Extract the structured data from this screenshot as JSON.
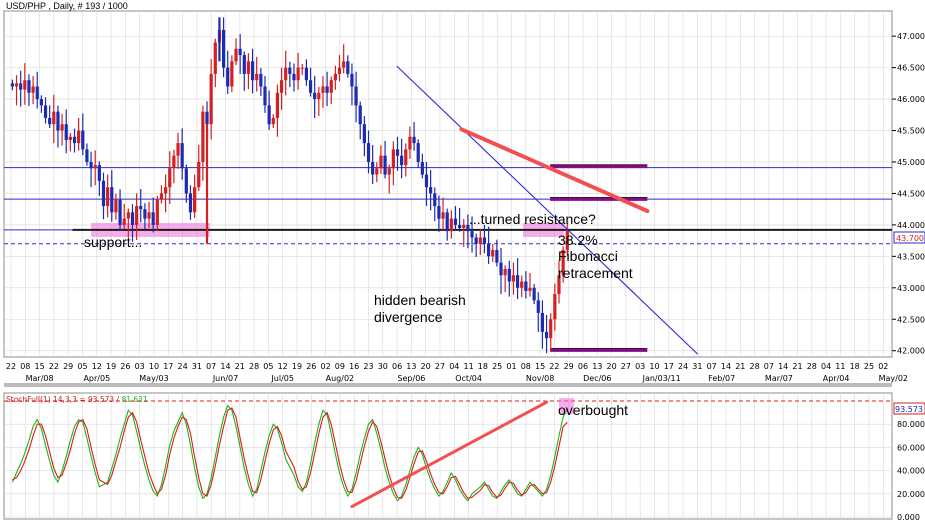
{
  "window": {
    "title": "USD/PHP , Daily, # 193 / 1000"
  },
  "colors": {
    "bull": "#d42020",
    "bear": "#1c2bb0",
    "hline": "#2a2ad6",
    "pivot": "#1a1a1a",
    "current": "#2a2ad6",
    "trend": "#f25050",
    "pink": "#f06ad8",
    "magenta": "#8a0a8a",
    "stochK": "#1db51d",
    "stochD": "#e01818",
    "grid": "#d8d8d8"
  },
  "annotations": {
    "support": "support...",
    "resistance": "...turned resistance?",
    "fib1": "38.2%",
    "fib2": "Fibonacci",
    "fib3": "retracement",
    "div1": "hidden bearish",
    "div2": "divergence",
    "overbought": "overbought"
  },
  "price_badge": "43.700",
  "stoch_badge": "93.573",
  "chart_data": [
    {
      "type": "candlestick",
      "title": "USD/PHP , Daily, # 193 / 1000",
      "y_ticks": [
        "47.000",
        "46.500",
        "46.000",
        "45.500",
        "45.000",
        "44.500",
        "44.000",
        "43.500",
        "43.000",
        "42.500",
        "42.000"
      ],
      "ylim": [
        41.9,
        47.4
      ],
      "x_day_labels": [
        "22",
        "08",
        "15",
        "22",
        "29",
        "05",
        "12",
        "19",
        "26",
        "03",
        "10",
        "17",
        "24",
        "31",
        "07",
        "14",
        "21",
        "28",
        "05",
        "12",
        "19",
        "26",
        "02",
        "09",
        "16",
        "23",
        "30",
        "06",
        "13",
        "20",
        "27",
        "04",
        "11",
        "18",
        "25",
        "01",
        "08",
        "15",
        "22",
        "29",
        "06",
        "13",
        "20",
        "27",
        "03",
        "10",
        "17",
        "24",
        "31",
        "07",
        "14",
        "21",
        "28",
        "07",
        "14",
        "21",
        "28",
        "04",
        "11",
        "18",
        "25",
        "02"
      ],
      "x_month_labels": [
        "Mar/08",
        "Apr/05",
        "May/03",
        "Jun/07",
        "Jul/05",
        "Aug/02",
        "Sep/06",
        "Oct/04",
        "Nov/08",
        "Dec/06",
        "Jan/03/11",
        "Feb/07",
        "Mar/07",
        "Apr/04",
        "May/02"
      ],
      "levels": [
        {
          "price": 44.91,
          "label": "resistance"
        },
        {
          "price": 44.41,
          "label": "resistance"
        },
        {
          "price": 43.92,
          "label": "support turned resistance"
        },
        {
          "price": 43.7,
          "label": "current price"
        }
      ],
      "magenta_levels": [
        44.93,
        44.41,
        42.01
      ],
      "current_price": 43.7,
      "closes": [
        46.2,
        46.25,
        46.15,
        46.3,
        46.1,
        46.2,
        46.0,
        45.9,
        45.7,
        45.6,
        45.8,
        45.5,
        45.6,
        45.35,
        45.4,
        45.3,
        45.5,
        45.2,
        45.0,
        44.9,
        44.95,
        44.7,
        44.3,
        44.6,
        44.2,
        44.4,
        44.0,
        44.1,
        44.2,
        44.0,
        44.3,
        44.25,
        44.1,
        44.2,
        44.0,
        44.4,
        44.5,
        44.6,
        44.9,
        45.1,
        45.3,
        44.9,
        44.5,
        44.2,
        44.6,
        45.0,
        45.8,
        45.6,
        46.4,
        46.9,
        47.1,
        46.5,
        46.2,
        46.6,
        46.8,
        46.7,
        46.4,
        46.6,
        46.3,
        46.4,
        46.2,
        45.9,
        45.6,
        45.7,
        46.1,
        46.3,
        46.5,
        46.4,
        46.3,
        46.5,
        46.5,
        46.3,
        46.1,
        46.0,
        46.1,
        46.2,
        46.1,
        46.3,
        46.4,
        46.5,
        46.6,
        46.4,
        46.2,
        45.9,
        45.6,
        45.3,
        45.0,
        44.8,
        44.9,
        45.1,
        44.8,
        44.9,
        45.2,
        45.1,
        44.95,
        45.2,
        45.4,
        45.3,
        45.0,
        44.8,
        44.6,
        44.5,
        44.3,
        44.1,
        44.2,
        43.9,
        44.1,
        44.0,
        43.95,
        44.0,
        43.9,
        43.8,
        43.7,
        43.8,
        43.7,
        43.5,
        43.6,
        43.4,
        43.2,
        43.3,
        43.1,
        43.2,
        43.0,
        43.1,
        42.95,
        43.0,
        42.8,
        42.6,
        42.3,
        42.2,
        42.5,
        42.9,
        43.2,
        43.6,
        43.9
      ],
      "volatility": "auto",
      "trendlines": [
        {
          "from": [
            27,
            46.52
          ],
          "to": [
            48,
            41.95
          ],
          "color": "hline"
        },
        {
          "from": [
            31.5,
            45.52
          ],
          "to": [
            44.5,
            44.22
          ],
          "color": "trend"
        }
      ]
    },
    {
      "type": "line",
      "title": "StochFull(1) 14,3,3 = 93.573 / 81.631",
      "y_ticks": [
        "100.000",
        "80.000",
        "60.000",
        "40.000",
        "20.000",
        "0.000"
      ],
      "ylim": [
        0,
        100
      ],
      "overbought_level": 100,
      "series": [
        {
          "name": "93.573",
          "values": [
            30,
            38,
            46,
            55,
            66,
            78,
            84,
            76,
            62,
            48,
            36,
            30,
            40,
            52,
            66,
            78,
            84,
            82,
            68,
            52,
            38,
            26,
            30,
            42,
            54,
            68,
            80,
            92,
            88,
            74,
            58,
            44,
            32,
            22,
            18,
            28,
            44,
            62,
            74,
            82,
            90,
            80,
            62,
            42,
            26,
            16,
            20,
            34,
            52,
            70,
            86,
            96,
            92,
            78,
            60,
            42,
            28,
            18,
            24,
            40,
            56,
            70,
            80,
            76,
            64,
            50,
            36,
            26,
            22,
            30,
            46,
            64,
            80,
            92,
            88,
            72,
            54,
            38,
            26,
            18,
            24,
            38,
            54,
            68,
            80,
            84,
            72,
            58,
            42,
            30,
            20,
            14,
            18,
            28,
            40,
            52,
            60,
            54,
            42,
            32,
            24,
            18,
            22,
            30,
            38,
            32,
            24,
            18,
            14,
            20,
            26,
            30,
            24,
            18,
            16,
            22,
            28,
            32,
            26,
            20,
            18,
            24,
            30,
            26,
            22,
            18,
            24,
            36,
            52,
            70,
            86,
            93.5
          ]
        },
        {
          "name": "81.631",
          "values": [
            32,
            34,
            40,
            48,
            58,
            70,
            80,
            80,
            70,
            56,
            42,
            34,
            36,
            46,
            58,
            72,
            82,
            84,
            76,
            60,
            45,
            32,
            28,
            36,
            48,
            60,
            74,
            86,
            90,
            82,
            66,
            52,
            38,
            28,
            20,
            24,
            36,
            54,
            68,
            78,
            86,
            84,
            72,
            52,
            34,
            20,
            18,
            28,
            44,
            62,
            78,
            92,
            94,
            86,
            68,
            50,
            35,
            22,
            21,
            32,
            48,
            63,
            75,
            78,
            70,
            57,
            43,
            31,
            24,
            26,
            38,
            55,
            72,
            86,
            90,
            80,
            63,
            46,
            32,
            22,
            21,
            31,
            46,
            61,
            74,
            82,
            78,
            65,
            50,
            36,
            25,
            17,
            16,
            23,
            34,
            46,
            56,
            57,
            48,
            37,
            28,
            21,
            20,
            26,
            34,
            35,
            28,
            21,
            16,
            17,
            23,
            28,
            27,
            21,
            17,
            19,
            25,
            30,
            29,
            23,
            19,
            21,
            27,
            28,
            24,
            20,
            21,
            30,
            44,
            61,
            78,
            81.6
          ]
        }
      ],
      "trendlines": [
        {
          "from": [
            80,
            9
          ],
          "to": [
            126,
            99
          ],
          "color": "trend"
        }
      ]
    }
  ]
}
